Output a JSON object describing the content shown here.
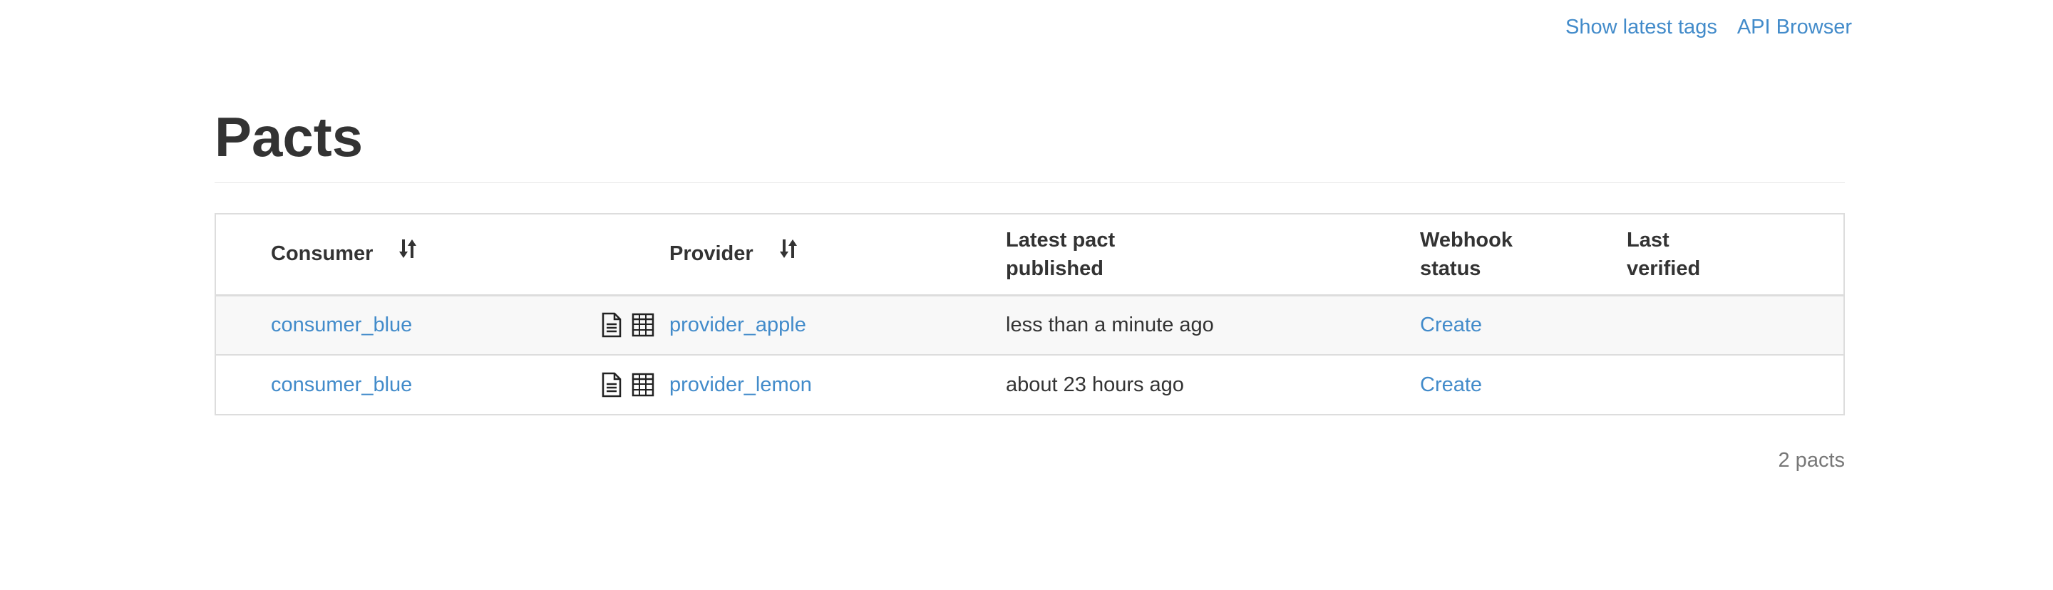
{
  "nav": {
    "show_latest_tags": "Show latest tags",
    "api_browser": "API Browser"
  },
  "page": {
    "title": "Pacts"
  },
  "table": {
    "headers": {
      "consumer": "Consumer",
      "provider": "Provider",
      "latest_pact_line1": "Latest pact",
      "latest_pact_line2": "published",
      "webhook_line1": "Webhook",
      "webhook_line2": "status",
      "last_verified_line1": "Last",
      "last_verified_line2": "verified"
    },
    "rows": [
      {
        "consumer": "consumer_blue",
        "provider": "provider_apple",
        "latest_pact_published": "less than a minute ago",
        "webhook_status": "Create",
        "last_verified": ""
      },
      {
        "consumer": "consumer_blue",
        "provider": "provider_lemon",
        "latest_pact_published": "about 23 hours ago",
        "webhook_status": "Create",
        "last_verified": ""
      }
    ]
  },
  "footer": {
    "count": "2 pacts"
  },
  "icons": {
    "sort": "sort-icon",
    "document": "document-icon",
    "matrix": "table-grid-icon"
  },
  "colors": {
    "link": "#428bca",
    "text": "#333333",
    "muted": "#777777",
    "border": "#dddddd",
    "stripe": "#f8f8f8"
  }
}
